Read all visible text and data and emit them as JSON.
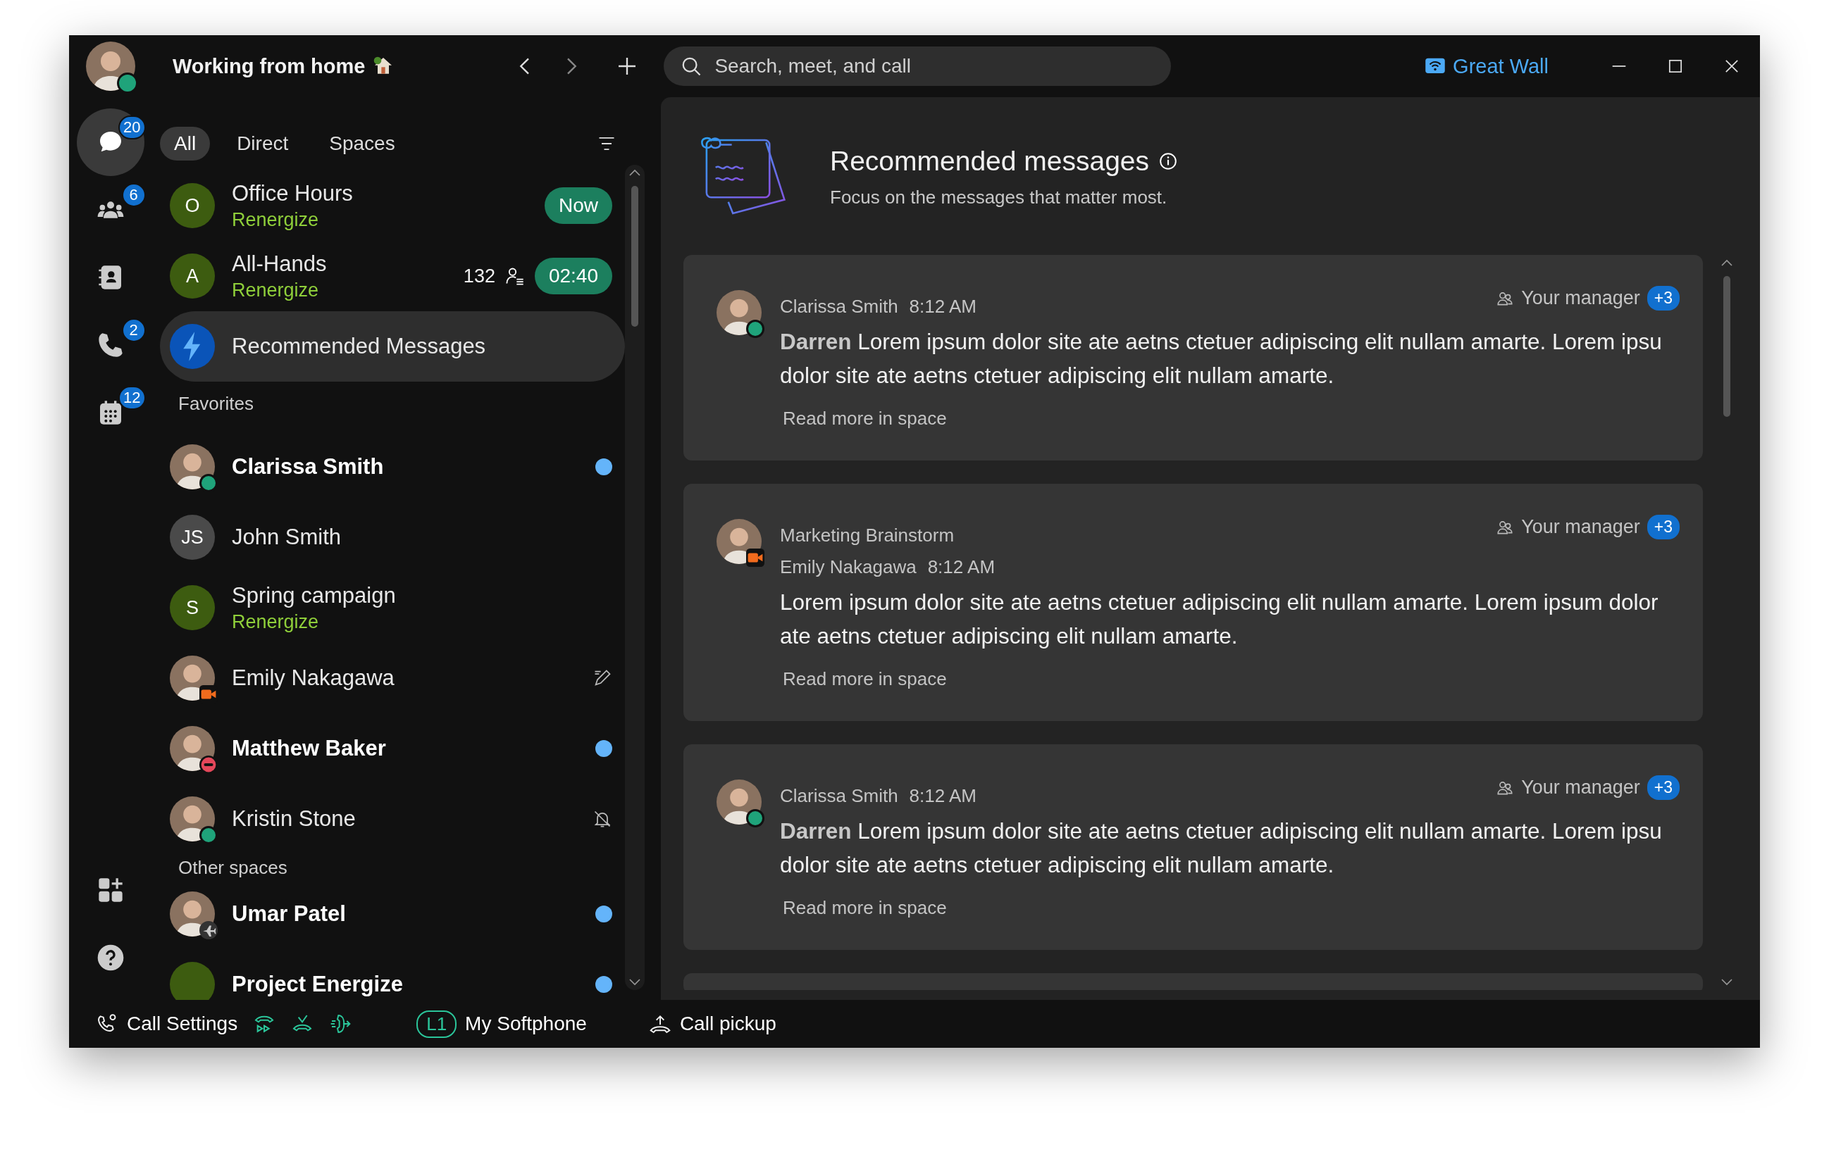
{
  "header": {
    "status_text": "Working from home",
    "presence": {
      "kind": "available"
    }
  },
  "search": {
    "placeholder": "Search, meet, and call"
  },
  "location": "Great Wall",
  "rail": [
    {
      "kind": "chat",
      "badge": "20",
      "selected": true
    },
    {
      "kind": "teams",
      "badge": "6",
      "selected": false
    },
    {
      "kind": "contacts",
      "selected": false
    },
    {
      "kind": "calls",
      "badge": "2",
      "selected": false
    },
    {
      "kind": "calendar",
      "badge": "12",
      "selected": false
    }
  ],
  "tabs": [
    {
      "label": "All",
      "selected": true
    },
    {
      "label": "Direct",
      "selected": false
    },
    {
      "label": "Spaces",
      "selected": false
    }
  ],
  "list": {
    "top": [
      {
        "kind": "space",
        "initial": "O",
        "color": "#3d5c10",
        "name": "Office Hours",
        "subtitle": "Renergize",
        "badge": "Now",
        "selected": false
      },
      {
        "kind": "space",
        "initial": "A",
        "color": "#3d5c10",
        "name": "All-Hands",
        "subtitle": "Renergize",
        "count": "132",
        "badge": "02:40",
        "selected": false
      },
      {
        "kind": "recommended",
        "name": "Recommended Messages",
        "selected": true
      }
    ],
    "sections": [
      {
        "title": "Favorites",
        "items": [
          {
            "kind": "person",
            "name": "Clarissa Smith",
            "presence": {
              "kind": "available"
            },
            "unread": true,
            "selected": false
          },
          {
            "kind": "space",
            "initial": "JS",
            "color": "#4a4a4a",
            "name": "John Smith",
            "unread": false,
            "selected": false
          },
          {
            "kind": "space",
            "initial": "S",
            "color": "#3d5c10",
            "name": "Spring campaign",
            "subtitle": "Renergize",
            "unread": false,
            "selected": false
          },
          {
            "kind": "person",
            "name": "Emily Nakagawa",
            "presence": {
              "kind": "meeting"
            },
            "indicator": {
              "kind": "draft"
            },
            "unread": false,
            "selected": false
          },
          {
            "kind": "person",
            "name": "Matthew Baker",
            "presence": {
              "kind": "dnd"
            },
            "unread": true,
            "selected": false
          },
          {
            "kind": "person",
            "name": "Kristin Stone",
            "presence": {
              "kind": "available"
            },
            "indicator": {
              "kind": "muted"
            },
            "unread": false,
            "selected": false
          }
        ]
      },
      {
        "title": "Other spaces",
        "items": [
          {
            "kind": "person",
            "name": "Umar Patel",
            "presence": {
              "kind": "travel"
            },
            "unread": true,
            "selected": false
          },
          {
            "kind": "space",
            "color": "#3d5c10",
            "name": "Project Energize",
            "unread": true,
            "selected": false
          }
        ]
      }
    ]
  },
  "panel": {
    "title": "Recommended messages",
    "subtitle": "Focus on the messages that matter most."
  },
  "cards": [
    {
      "sender": "Clarissa Smith",
      "time": "8:12 AM",
      "presence": {
        "kind": "available"
      },
      "tag": "Your manager",
      "extra": "+3",
      "lines": [
        "**Darren** Lorem ipsum dolor site ate aetns ctetuer adipiscing elit nullam amarte. Lorem ipsu",
        "dolor site ate aetns ctetuer adipiscing elit nullam amarte."
      ],
      "link": "Read more in space"
    },
    {
      "space": "Marketing Brainstorm",
      "sender": "Emily Nakagawa",
      "time": "8:12 AM",
      "presence": {
        "kind": "meeting"
      },
      "tag": "Your manager",
      "extra": "+3",
      "lines": [
        "Lorem ipsum dolor site ate aetns ctetuer adipiscing elit nullam amarte. Lorem ipsum dolor",
        "ate aetns ctetuer adipiscing elit nullam amarte."
      ],
      "link": "Read more in space"
    },
    {
      "sender": "Clarissa Smith",
      "time": "8:12 AM",
      "presence": {
        "kind": "available"
      },
      "tag": "Your manager",
      "extra": "+3",
      "lines": [
        "**Darren** Lorem ipsum dolor site ate aetns ctetuer adipiscing elit nullam amarte. Lorem ipsu",
        "dolor site ate aetns ctetuer adipiscing elit nullam amarte."
      ],
      "link": "Read more in space"
    }
  ],
  "bottom_bar": {
    "call_settings": "Call Settings",
    "line": "L1",
    "softphone": "My Softphone",
    "pickup": "Call pickup"
  }
}
